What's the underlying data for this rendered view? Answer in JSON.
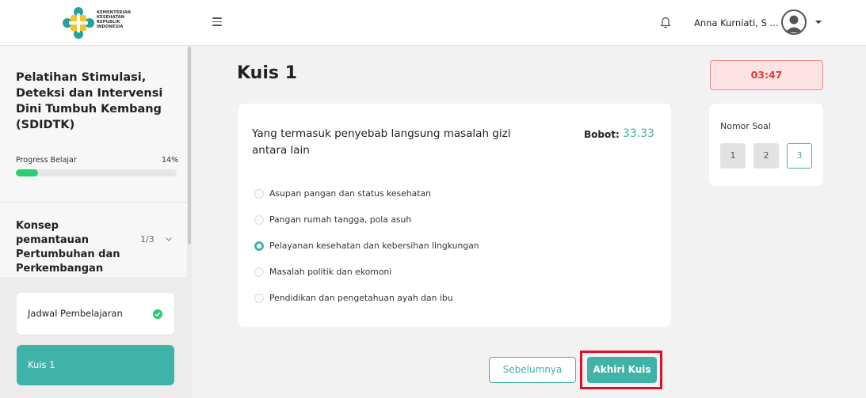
{
  "header": {
    "logo_lines": [
      "KEMENTERIAN",
      "KESEHATAN",
      "REPUBLIK",
      "INDONESIA"
    ],
    "user_name": "Anna Kurniati, S ...",
    "icons": [
      "menu-icon",
      "bell-icon",
      "avatar-icon",
      "caret-down-icon"
    ]
  },
  "sidebar": {
    "course_title": "Pelatihan Stimulasi, Deteksi dan Intervensi Dini Tumbuh Kembang (SDIDTK)",
    "progress_label": "Progress Belajar",
    "progress_percent_text": "14%",
    "progress_fraction": 0.14,
    "module_title": "Konsep pemantauan Pertumbuhan dan Perkembangan anak",
    "module_count": "1/3",
    "lessons": [
      {
        "label": "Jadwal Pembelajaran",
        "completed": true
      },
      {
        "label": "Kuis 1",
        "active": true
      }
    ]
  },
  "main": {
    "quiz_title": "Kuis 1",
    "timer": "03:47",
    "question": "Yang termasuk penyebab langsung masalah gizi antara lain",
    "weight_label": "Bobot:",
    "weight_value": "33.33",
    "options": [
      {
        "label": "Asupan pangan dan status kesehatan",
        "selected": false
      },
      {
        "label": "Pangan rumah tangga, pola asuh",
        "selected": false
      },
      {
        "label": "Pelayanan kesehatan dan kebersihan lingkungan",
        "selected": true
      },
      {
        "label": "Masalah politik dan ekomoni",
        "selected": false
      },
      {
        "label": "Pendidikan dan pengetahuan ayah dan ibu",
        "selected": false
      }
    ],
    "navigator_title": "Nomor Soal",
    "question_numbers": [
      "1",
      "2",
      "3"
    ],
    "current_question": "3",
    "prev_button": "Sebelumnya",
    "finish_button": "Akhiri Kuis"
  },
  "colors": {
    "accent": "#40b3a8",
    "success": "#2ecc71",
    "timer_text": "#e03b3b",
    "highlight_frame": "#e0102c"
  }
}
